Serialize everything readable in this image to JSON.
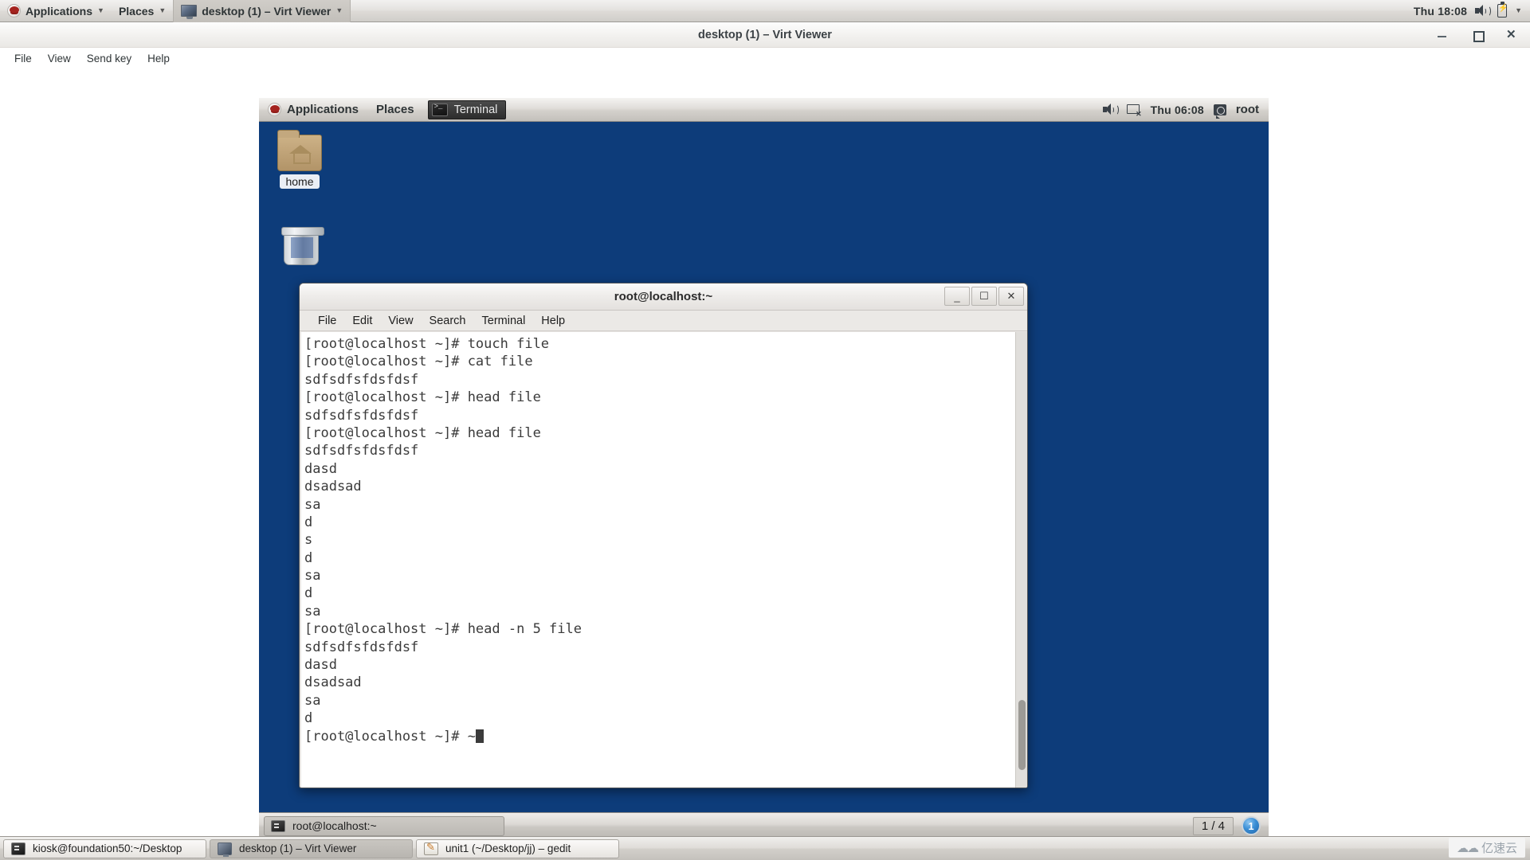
{
  "host_panel": {
    "logo_icon": "redhat-icon",
    "menus": [
      {
        "label": "Applications",
        "has_caret": true
      },
      {
        "label": "Places",
        "has_caret": true
      }
    ],
    "active_window": {
      "label": "desktop (1) – Virt Viewer",
      "icon": "screen-icon",
      "has_caret": true
    },
    "clock": "Thu 18:08",
    "icons": [
      "volume-icon",
      "battery-icon",
      "dropdown-caret-icon"
    ]
  },
  "virt_viewer": {
    "title": "desktop (1) – Virt Viewer",
    "window_buttons": [
      "minimize",
      "maximize",
      "close"
    ],
    "menu": [
      "File",
      "View",
      "Send key",
      "Help"
    ]
  },
  "guest_panel": {
    "logo_icon": "redhat-icon",
    "menus": [
      {
        "label": "Applications"
      },
      {
        "label": "Places"
      }
    ],
    "active_window": {
      "label": "Terminal",
      "icon": "terminal-icon"
    },
    "clock": "Thu 06:08",
    "user": "root",
    "icons": [
      "volume-icon",
      "network-disconnected-icon",
      "user-icon"
    ]
  },
  "desktop_icons": [
    {
      "name": "home",
      "icon": "home-folder-icon"
    },
    {
      "name": "",
      "icon": "trash-icon"
    }
  ],
  "terminal": {
    "title": "root@localhost:~",
    "window_buttons": [
      "minimize",
      "maximize",
      "close"
    ],
    "menu": [
      "File",
      "Edit",
      "View",
      "Search",
      "Terminal",
      "Help"
    ],
    "lines": [
      "[root@localhost ~]# touch file",
      "[root@localhost ~]# cat file",
      "sdfsdfsfdsfdsf",
      "[root@localhost ~]# head file",
      "sdfsdfsfdsfdsf",
      "[root@localhost ~]# head file",
      "sdfsdfsfdsfdsf",
      "dasd",
      "dsadsad",
      "sa",
      "d",
      "s",
      "d",
      "sa",
      "d",
      "sa",
      "[root@localhost ~]# head -n 5 file",
      "sdfsdfsfdsfdsf",
      "dasd",
      "dsadsad",
      "sa",
      "d"
    ],
    "prompt": "[root@localhost ~]# ~",
    "cursor": "block"
  },
  "guest_taskbar": {
    "tasks": [
      {
        "label": "root@localhost:~",
        "icon": "terminal-icon",
        "active": true
      }
    ],
    "workspace_indicator": "1 / 4",
    "workspace_number": "1"
  },
  "host_taskbar": {
    "tasks": [
      {
        "label": "kiosk@foundation50:~/Desktop",
        "icon": "terminal-icon",
        "active": false
      },
      {
        "label": "desktop (1) – Virt Viewer",
        "icon": "screen-icon",
        "active": true
      },
      {
        "label": "unit1 (~/Desktop/jj) – gedit",
        "icon": "gedit-icon",
        "active": false
      }
    ]
  },
  "watermark": {
    "text": "亿速云",
    "icon": "cloud-icon"
  },
  "colors": {
    "desktop_blue": "#0d3c7a",
    "panel_gray": "#dedbd7",
    "terminal_bg": "#ffffff",
    "terminal_fg": "#3b3b3b",
    "accent_blue": "#3b8fd6"
  }
}
